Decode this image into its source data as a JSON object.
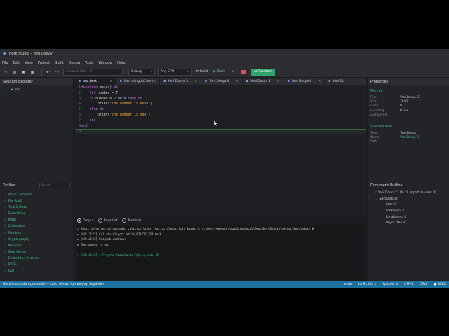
{
  "window": {
    "title": "Berk Studio - Yeni Dosya*"
  },
  "menu": [
    "File",
    "Edit",
    "View",
    "Project",
    "Build",
    "Debug",
    "Tools",
    "Window",
    "Help"
  ],
  "toolbar": {
    "search_placeholder": "Search (Ctrl+F)",
    "config": "Debug",
    "platform": "Any CPU",
    "build_label": "Build",
    "start_label": "Start",
    "ai_label": "AI Assistant"
  },
  "solution_explorer": {
    "title": "Solution Explorer",
    "items": [
      {
        "label": "src"
      }
    ]
  },
  "toolbox": {
    "title": "Toolbox",
    "search_placeholder": "Search...",
    "items": [
      "Basic Elements",
      "File & I/O",
      "Text & Data",
      "Formatting",
      "Math",
      "Collections",
      "Random",
      "Cryptography",
      "Network",
      "Web Server",
      "Embedded Systems",
      "RTOS",
      "GUI"
    ]
  },
  "tabs": [
    {
      "label": "ana.berk",
      "active": true
    },
    {
      "label": "iken döngüsü.berk"
    },
    {
      "label": "Yeni Dosya 3"
    },
    {
      "label": "Yeni Dosya 4"
    },
    {
      "label": "Yeni Dosya 5"
    },
    {
      "label": "Yeni Dosya 6"
    },
    {
      "label": "Yeni Do"
    }
  ],
  "code_lines": [
    {
      "n": "1",
      "tokens": [
        {
          "t": "function",
          "c": "kw"
        },
        {
          "t": " main() "
        },
        {
          "t": "do",
          "c": "kw"
        }
      ]
    },
    {
      "n": "2",
      "tokens": [
        {
          "t": "    "
        },
        {
          "t": "let",
          "c": "kw"
        },
        {
          "t": " number = 7"
        }
      ]
    },
    {
      "n": "3",
      "tokens": [
        {
          "t": "    "
        },
        {
          "t": "if",
          "c": "kw"
        },
        {
          "t": " number % 2 == 0 "
        },
        {
          "t": "then do",
          "c": "kw"
        }
      ]
    },
    {
      "n": "4",
      "tokens": [
        {
          "t": "        print("
        },
        {
          "t": "\"The number is even\"",
          "c": "str"
        },
        {
          "t": ")"
        }
      ]
    },
    {
      "n": "5",
      "tokens": [
        {
          "t": "    "
        },
        {
          "t": "else do",
          "c": "kw"
        }
      ]
    },
    {
      "n": "6",
      "tokens": [
        {
          "t": "        print("
        },
        {
          "t": "\"The number is odd\"",
          "c": "str"
        },
        {
          "t": ")"
        }
      ]
    },
    {
      "n": "7",
      "tokens": [
        {
          "t": "    "
        },
        {
          "t": "end",
          "c": "kw"
        }
      ]
    },
    {
      "n": "8",
      "tokens": [
        {
          "t": "end",
          "c": "kw"
        }
      ]
    },
    {
      "n": "9",
      "tokens": []
    }
  ],
  "output": {
    "tabs": [
      "Output",
      "Error List",
      "Terminal"
    ],
    "lines": [
      {
        "text": "⚠ Adsız belge geçici dosyadan çalıştırılıyor (kalıcı olması için kaydet): C:\\Users\\meester\\AppData\\Local\\Temp\\BerkStudio\\gecici-kosu\\adsiz_0",
        "green": false
      },
      {
        "text": "► [03:12:22] Çalıştırılıyor: adsiz_031222_763.berk",
        "green": false
      },
      {
        "text": "► [03:12:22] Program çıktısı:",
        "green": false
      },
      {
        "text": "► The number is odd",
        "green": false
      },
      {
        "text": "",
        "green": false
      },
      {
        "text": "✓ [03:12:22] ✓ Program tamamlandı (Çıkış kodu: 0)",
        "green": true
      }
    ]
  },
  "properties": {
    "title": "Properties",
    "file_info_title": "File Info",
    "file_info": [
      {
        "k": "File:",
        "v": "Yeni Dosya 27"
      },
      {
        "k": "Size:",
        "v": "164 B"
      },
      {
        "k": "Lines:",
        "v": "9"
      },
      {
        "k": "Encoding:",
        "v": "UTF-8"
      },
      {
        "k": "Last Saved:",
        "v": ""
      }
    ],
    "selected_title": "Selected Item",
    "selected": [
      {
        "k": "Type:",
        "v": "Yeni Dosya"
      },
      {
        "k": "Name:",
        "v": "Yeni Dosya 27"
      },
      {
        "k": "Path:",
        "v": ""
      }
    ]
  },
  "outline": {
    "title": "Document Outline",
    "root": "Yeni Dosya 27  (fn: 0, import: 0, satır: 9)",
    "group": "İstatistikler",
    "stats": [
      "Satır: 9",
      "Fonksiyon: 0",
      "İçe aktarım: 0",
      "Boyut: 164 B"
    ]
  },
  "status": {
    "message": "Geçici dosyadan çalıştırıldı — kalıcı olması için belgeyi kaydedin",
    "items": [
      "main",
      "Ln 9 , Col 1",
      "Spaces: 4",
      "UTF-8",
      "CRLF",
      "● BERK"
    ]
  },
  "colors": {
    "accent_green": "#2ea36b",
    "statusbar": "#1d6f9e",
    "keyword": "#c678dd",
    "string": "#e5a24b"
  }
}
